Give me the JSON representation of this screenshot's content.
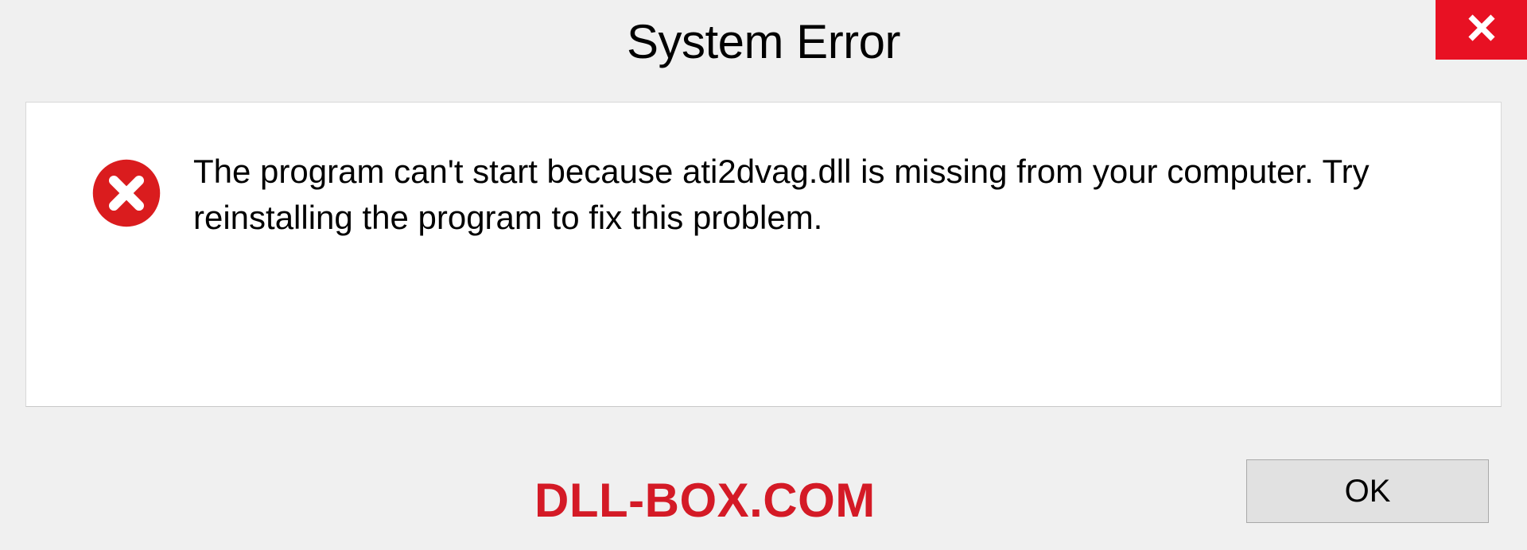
{
  "dialog": {
    "title": "System Error",
    "message": "The program can't start because ati2dvag.dll is missing from your computer. Try reinstalling the program to fix this problem.",
    "ok_label": "OK"
  },
  "watermark": "DLL-BOX.COM",
  "colors": {
    "close_bg": "#e81123",
    "error_icon": "#da1c1e",
    "watermark": "#d41a26"
  }
}
